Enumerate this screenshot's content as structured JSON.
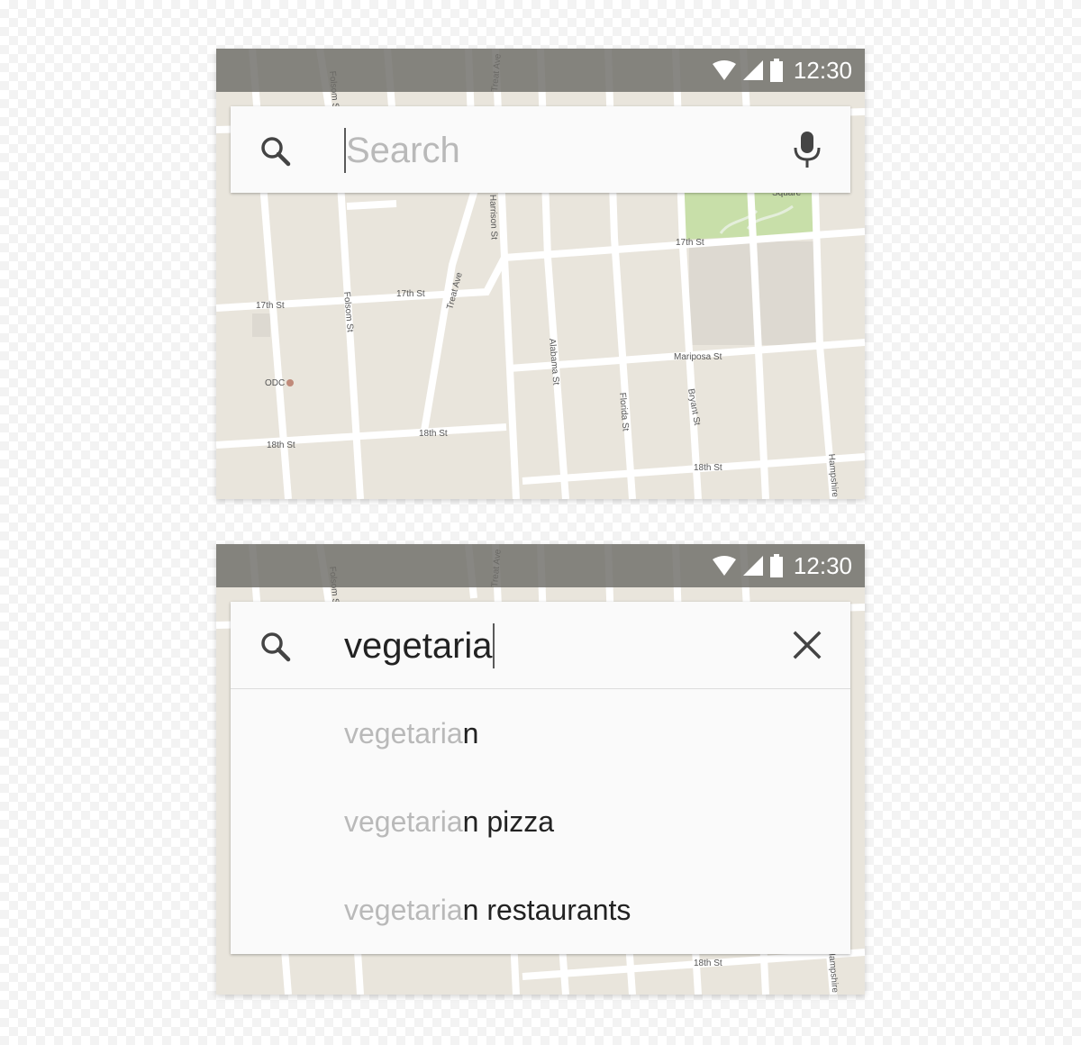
{
  "status_bar": {
    "time": "12:30",
    "icons": [
      "wifi-icon",
      "signal-icon",
      "battery-icon"
    ],
    "background": "#6e6c68"
  },
  "map": {
    "labels": {
      "folsom_st": "Folsom St",
      "treat_ave": "Treat Ave",
      "alabama_st": "Alabama St",
      "harrison_st": "Harrison St",
      "square": "Square",
      "st_17th": "17th St",
      "st_18th": "18th St",
      "florida_st": "Florida St",
      "bryant_st": "Bryant St",
      "mariposa_st": "Mariposa St",
      "hampshire_st": "Hampshire St",
      "odc": "ODC"
    },
    "colors": {
      "land": "#e9e5dc",
      "road": "#ffffff",
      "park": "#c8dfa9",
      "block": "#ddd9d1"
    }
  },
  "screen_empty": {
    "search": {
      "placeholder": "Search",
      "left_icon": "search-icon",
      "right_icon": "mic-icon"
    }
  },
  "screen_typing": {
    "search": {
      "value": "vegetaria",
      "left_icon": "search-icon",
      "right_icon": "close-icon"
    },
    "suggestions": [
      {
        "typed": "vegetaria",
        "rest": "n"
      },
      {
        "typed": "vegetaria",
        "rest": "n pizza"
      },
      {
        "typed": "vegetaria",
        "rest": "n restaurants"
      }
    ]
  }
}
